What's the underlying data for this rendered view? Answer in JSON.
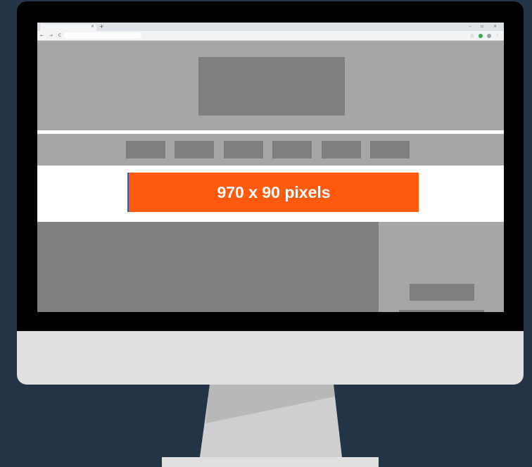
{
  "browser": {
    "tab_close": "×",
    "new_tab": "+",
    "window_controls": "–  ▫  ×",
    "nav_buttons": "← → C",
    "extension_icons": [
      "star-icon",
      "check-circle-icon",
      "profile-icon",
      "menu-icon"
    ]
  },
  "page": {
    "ad_banner": {
      "text": "970 x 90 pixels",
      "color": "#fe5a0e"
    },
    "nav_items_count": 6
  },
  "colors": {
    "background": "#243447",
    "placeholder_light": "#a6a6a6",
    "placeholder_dark": "#7f7f7f",
    "ad_orange": "#fe5a0e"
  }
}
